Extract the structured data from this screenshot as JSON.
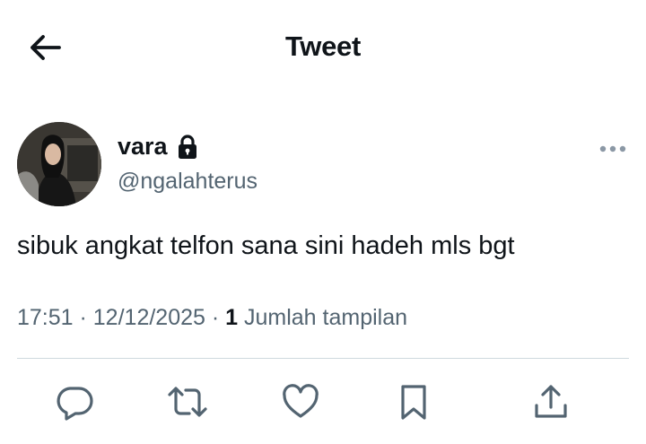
{
  "header": {
    "title": "Tweet",
    "back_icon": "arrow-left-icon"
  },
  "tweet": {
    "author": {
      "display_name": "vara",
      "handle": "@ngalahterus",
      "protected_icon": "lock-icon"
    },
    "text": "sibuk angkat telfon sana sini hadeh mls bgt",
    "time": "17:51",
    "separator": " · ",
    "date": "12/12/2025",
    "view_count": "1",
    "view_label": " Jumlah tampilan"
  },
  "actions": [
    "reply-icon",
    "retweet-icon",
    "like-icon",
    "bookmark-icon",
    "share-icon"
  ],
  "colors": {
    "text_primary": "#0f1419",
    "text_secondary": "#536471",
    "divider": "#cfd9de",
    "icon": "#536471"
  }
}
